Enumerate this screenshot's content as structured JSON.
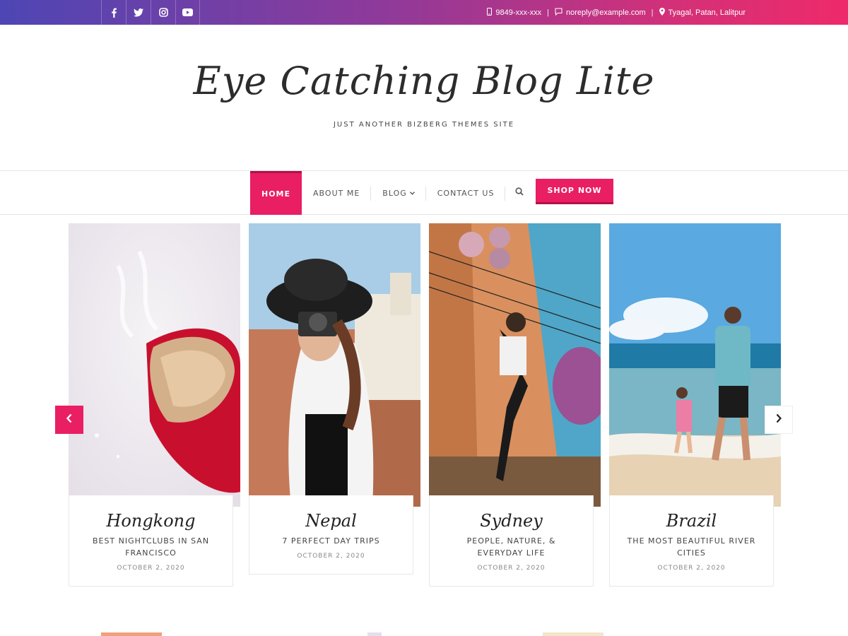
{
  "topbar": {
    "social": [
      "facebook-icon",
      "twitter-icon",
      "instagram-icon",
      "youtube-icon"
    ],
    "phone": "9849-xxx-xxx",
    "email": "noreply@example.com",
    "address": "Tyagal, Patan, Lalitpur",
    "separator": "|"
  },
  "header": {
    "title": "Eye Catching Blog Lite",
    "tagline": "JUST ANOTHER BIZBERG THEMES SITE"
  },
  "nav": {
    "items": [
      {
        "label": "HOME",
        "active": true
      },
      {
        "label": "ABOUT ME",
        "active": false
      },
      {
        "label": "BLOG",
        "active": false
      },
      {
        "label": "CONTACT US",
        "active": false
      }
    ],
    "shop_label": "SHOP NOW"
  },
  "slider": {
    "cards": [
      {
        "place": "Hongkong",
        "title": "BEST NIGHTCLUBS IN SAN FRANCISCO",
        "date": "OCTOBER 2, 2020"
      },
      {
        "place": "Nepal",
        "title": "7 PERFECT DAY TRIPS",
        "date": "OCTOBER 2, 2020"
      },
      {
        "place": "Sydney",
        "title": "PEOPLE, NATURE, & EVERYDAY LIFE",
        "date": "OCTOBER 2, 2020"
      },
      {
        "place": "Brazil",
        "title": "THE MOST BEAUTIFUL RIVER CITIES",
        "date": "OCTOBER 2, 2020"
      }
    ]
  },
  "colors": {
    "accent": "#e91e63",
    "gradient_start": "#4e46b4",
    "gradient_end": "#ee2a6a"
  }
}
